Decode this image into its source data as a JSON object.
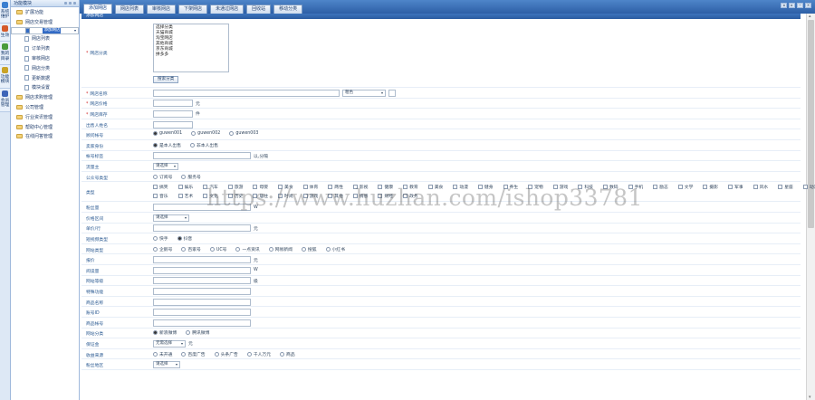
{
  "vtabs": [
    {
      "label": "系统维护",
      "color": "#3a7fd0"
    },
    {
      "label": "生效",
      "color": "#d45a2a"
    },
    {
      "label": "我的目录",
      "color": "#4a9b3a"
    },
    {
      "label": "功能模块",
      "color": "#c9a326"
    },
    {
      "label": "会员管理",
      "color": "#3c64b8"
    }
  ],
  "tree": {
    "header": "功能模块",
    "nodes": [
      {
        "label": "扩展功能",
        "level": 1,
        "type": "folder"
      },
      {
        "label": "网店交易管理",
        "level": 1,
        "type": "folder"
      },
      {
        "label": "添加网店",
        "level": 2,
        "type": "doc",
        "selected": true
      },
      {
        "label": "网店列表",
        "level": 2,
        "type": "doc"
      },
      {
        "label": "订单列表",
        "level": 2,
        "type": "doc"
      },
      {
        "label": "审核网店",
        "level": 2,
        "type": "doc"
      },
      {
        "label": "网店分类",
        "level": 2,
        "type": "doc"
      },
      {
        "label": "更新数据",
        "level": 2,
        "type": "doc"
      },
      {
        "label": "模块设置",
        "level": 2,
        "type": "doc"
      },
      {
        "label": "网店求购管理",
        "level": 1,
        "type": "folder"
      },
      {
        "label": "公司管理",
        "level": 1,
        "type": "folder"
      },
      {
        "label": "行业资讯管理",
        "level": 1,
        "type": "folder"
      },
      {
        "label": "帮助中心管理",
        "level": 1,
        "type": "folder"
      },
      {
        "label": "在线问答管理",
        "level": 1,
        "type": "folder"
      }
    ]
  },
  "tabs": [
    "添加网店",
    "网店列表",
    "审核网店",
    "下架网店",
    "未通过网店",
    "回收站",
    "移动分类"
  ],
  "window_buttons": [
    "◂",
    "▸",
    "‒",
    "×"
  ],
  "section_title": "添加网店",
  "watermark": "https://www.huzhan.com/ishop33781",
  "form": {
    "category": {
      "label": "网店分类",
      "options": [
        "选择分类",
        "天猫商城",
        "淘宝网店",
        "其他商城",
        "京东商城",
        "拼多多"
      ],
      "button": "搜索分类"
    },
    "name": {
      "label": "网店名称",
      "select": "粗色"
    },
    "price": {
      "label": "网店价格",
      "unit": "元"
    },
    "stock": {
      "label": "网店库存",
      "unit": "件"
    },
    "seller": {
      "label": "出售人姓名"
    },
    "consultant": {
      "label": "顾问帐号",
      "options": [
        "guwen001",
        "guwen002",
        "guwen003"
      ],
      "selected": 0
    },
    "identity": {
      "label": "卖家身份",
      "options": [
        "是本人出售",
        "非本人出售"
      ],
      "selected": 0
    },
    "tags": {
      "label": "帐号标签",
      "note": "以,分隔"
    },
    "traffic_source": {
      "label": "流量主",
      "select": "请选择"
    },
    "public_type": {
      "label": "公众号类型",
      "options": [
        "订阅号",
        "服务号"
      ]
    },
    "industry": {
      "label": "类型",
      "row1": [
        "搞笑",
        "娱乐",
        "汽车",
        "旅游",
        "母婴",
        "美食",
        "体育",
        "两性",
        "影视",
        "健康",
        "教育",
        "美食",
        "动漫",
        "健身",
        "养生",
        "宠物",
        "游戏",
        "科技",
        "数码",
        "手机",
        "励志",
        "文学",
        "摄影",
        "军事",
        "风水",
        "星座",
        "动漫"
      ],
      "row2": [
        "音乐",
        "艺术",
        "文化",
        "历史",
        "居住",
        "时尚",
        "游戏",
        "其他",
        "情感",
        "财经",
        "政务"
      ]
    },
    "fans": {
      "label": "粉丝量",
      "unit": "W"
    },
    "price_range": {
      "label": "价格区间",
      "select": "请选择"
    },
    "unit_price": {
      "label": "单价/行",
      "unit": "元"
    },
    "short_video": {
      "label": "短视频类型",
      "options": [
        "快手",
        "抖音"
      ],
      "selected": 1
    },
    "site_type": {
      "label": "网站类型",
      "options": [
        "企鹅号",
        "百家号",
        "UC号",
        "一点资讯",
        "网易新闻",
        "搜狐",
        "小红书"
      ]
    },
    "price2": {
      "label": "报价",
      "unit": "元"
    },
    "reads": {
      "label": "阅读量",
      "unit": "W"
    },
    "level": {
      "label": "网站等级",
      "unit": "级"
    },
    "special": {
      "label": "特殊功能"
    },
    "product_name": {
      "label": "商品名称"
    },
    "account_id": {
      "label": "账号ID"
    },
    "product_acct": {
      "label": "商品帐号"
    },
    "site_cat": {
      "label": "网站分类",
      "options": [
        "新浪微博",
        "腾讯微博"
      ],
      "selected": 0
    },
    "deposit": {
      "label": "保证金",
      "select": "无需选择",
      "unit": "元"
    },
    "income": {
      "label": "收益来源",
      "options": [
        "未开通",
        "百度广告",
        "头条广告",
        "千人万元",
        "商品"
      ]
    },
    "location": {
      "label": "粉丝地区",
      "select": "请选择"
    }
  }
}
